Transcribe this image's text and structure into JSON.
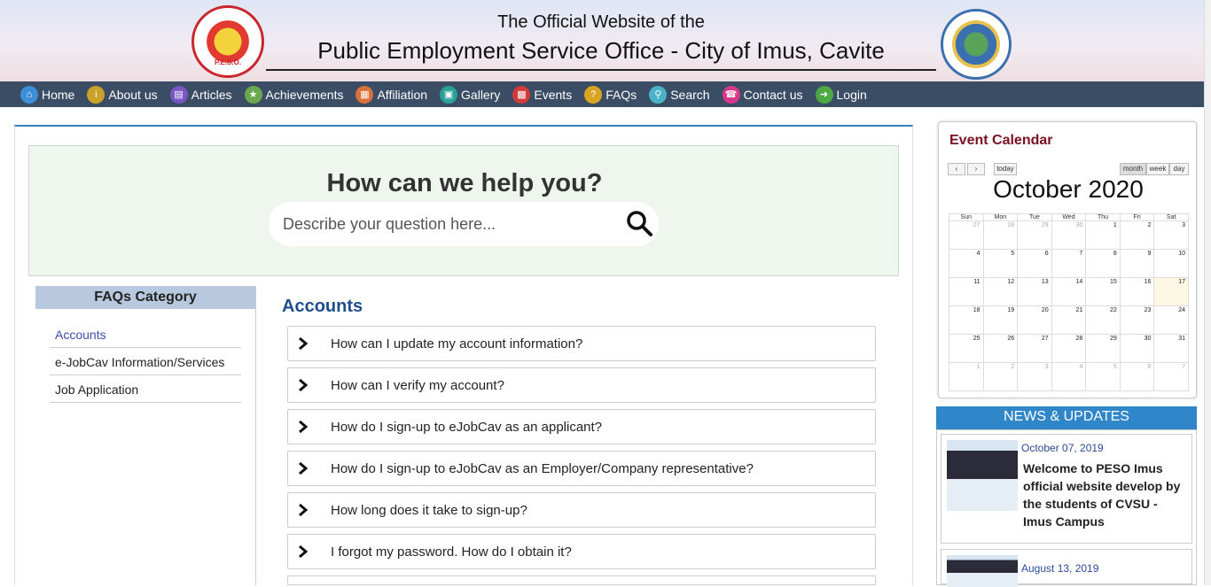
{
  "header": {
    "line1": "The Official Website of the",
    "line2": "Public Employment Service Office - City of Imus, Cavite"
  },
  "nav": [
    {
      "label": "Home",
      "icon": "home-icon",
      "color": "#3b8ed8"
    },
    {
      "label": "About us",
      "icon": "info-icon",
      "color": "#c9a227"
    },
    {
      "label": "Articles",
      "icon": "articles-icon",
      "color": "#7a55c4"
    },
    {
      "label": "Achievements",
      "icon": "trophy-icon",
      "color": "#6aa84f"
    },
    {
      "label": "Affiliation",
      "icon": "building-icon",
      "color": "#d9713a"
    },
    {
      "label": "Gallery",
      "icon": "image-icon",
      "color": "#2aa198"
    },
    {
      "label": "Events",
      "icon": "calendar-icon",
      "color": "#d33a3a"
    },
    {
      "label": "FAQs",
      "icon": "question-icon",
      "color": "#d9a520"
    },
    {
      "label": "Search",
      "icon": "search-icon",
      "color": "#4bb3c9"
    },
    {
      "label": "Contact us",
      "icon": "phone-icon",
      "color": "#d8388a"
    },
    {
      "label": "Login",
      "icon": "login-icon",
      "color": "#4ca843"
    }
  ],
  "help": {
    "title": "How can we help you?",
    "placeholder": "Describe your question here..."
  },
  "faq_category": {
    "title": "FAQs Category",
    "items": [
      "Accounts",
      "e-JobCav Information/Services",
      "Job Application"
    ]
  },
  "faq_section": {
    "title": "Accounts",
    "questions": [
      "How can I update my account information?",
      "How can I verify my account?",
      "How do I sign-up to eJobCav as an applicant?",
      "How do I sign-up to eJobCav as an Employer/Company representative?",
      "How long does it take to sign-up?",
      "I forgot my password. How do I obtain it?"
    ]
  },
  "calendar": {
    "title": "Event Calendar",
    "today_label": "today",
    "view_month": "month",
    "view_week": "week",
    "view_day": "day",
    "month_title": "October 2020",
    "weekdays": [
      "Sun",
      "Mon",
      "Tue",
      "Wed",
      "Thu",
      "Fri",
      "Sat"
    ],
    "weeks": [
      [
        "27",
        "28",
        "29",
        "30",
        "1",
        "2",
        "3"
      ],
      [
        "4",
        "5",
        "6",
        "7",
        "8",
        "9",
        "10"
      ],
      [
        "11",
        "12",
        "13",
        "14",
        "15",
        "16",
        "17"
      ],
      [
        "18",
        "19",
        "20",
        "21",
        "22",
        "23",
        "24"
      ],
      [
        "25",
        "26",
        "27",
        "28",
        "29",
        "30",
        "31"
      ],
      [
        "1",
        "2",
        "3",
        "4",
        "5",
        "6",
        "7"
      ]
    ]
  },
  "news": {
    "heading": "NEWS & UPDATES",
    "items": [
      {
        "date": "October 07, 2019",
        "title": "Welcome to PESO Imus official website develop by the students of CVSU - Imus Campus"
      },
      {
        "date": "August 13, 2019",
        "title": ""
      }
    ]
  }
}
